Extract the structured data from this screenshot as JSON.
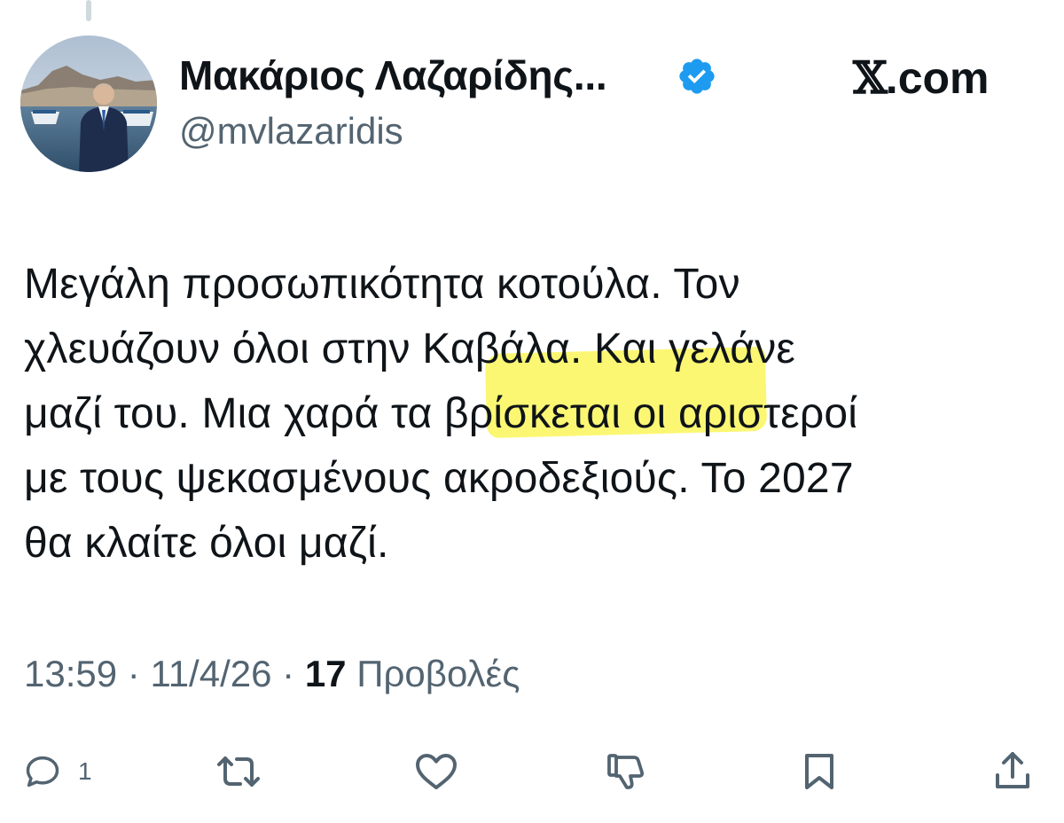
{
  "author": {
    "display_name": "Μακάριος Λαζαρίδης...",
    "handle": "@mvlazaridis",
    "verified": true
  },
  "brand": {
    "logo_letter": "𝕏",
    "domain_suffix": ".com"
  },
  "tweet": {
    "lines": [
      "Μεγάλη προσωπικότητα κοτούλα. Τον",
      "χλευάζουν όλοι στην Καβάλα. Και γελάνε",
      "μαζί του. Μια χαρά τα βρίσκεται οι αριστεροί",
      "με τους ψεκασμένους ακροδεξιούς. Το 2027",
      "θα κλαίτε όλοι μαζί."
    ],
    "highlighted_phrase": "βρίσκεται"
  },
  "meta": {
    "time": "13:59",
    "separator": "·",
    "date": "11/4/26",
    "views_count": "17",
    "views_label": "Προβολές"
  },
  "actions": {
    "reply_count": "1",
    "icons": [
      "reply-icon",
      "retweet-icon",
      "like-icon",
      "dislike-icon",
      "bookmark-icon",
      "share-icon"
    ]
  },
  "colors": {
    "text": "#0f1419",
    "secondary": "#536471",
    "verified_badge": "#1d9bf0",
    "highlight": "#fbf65a"
  }
}
